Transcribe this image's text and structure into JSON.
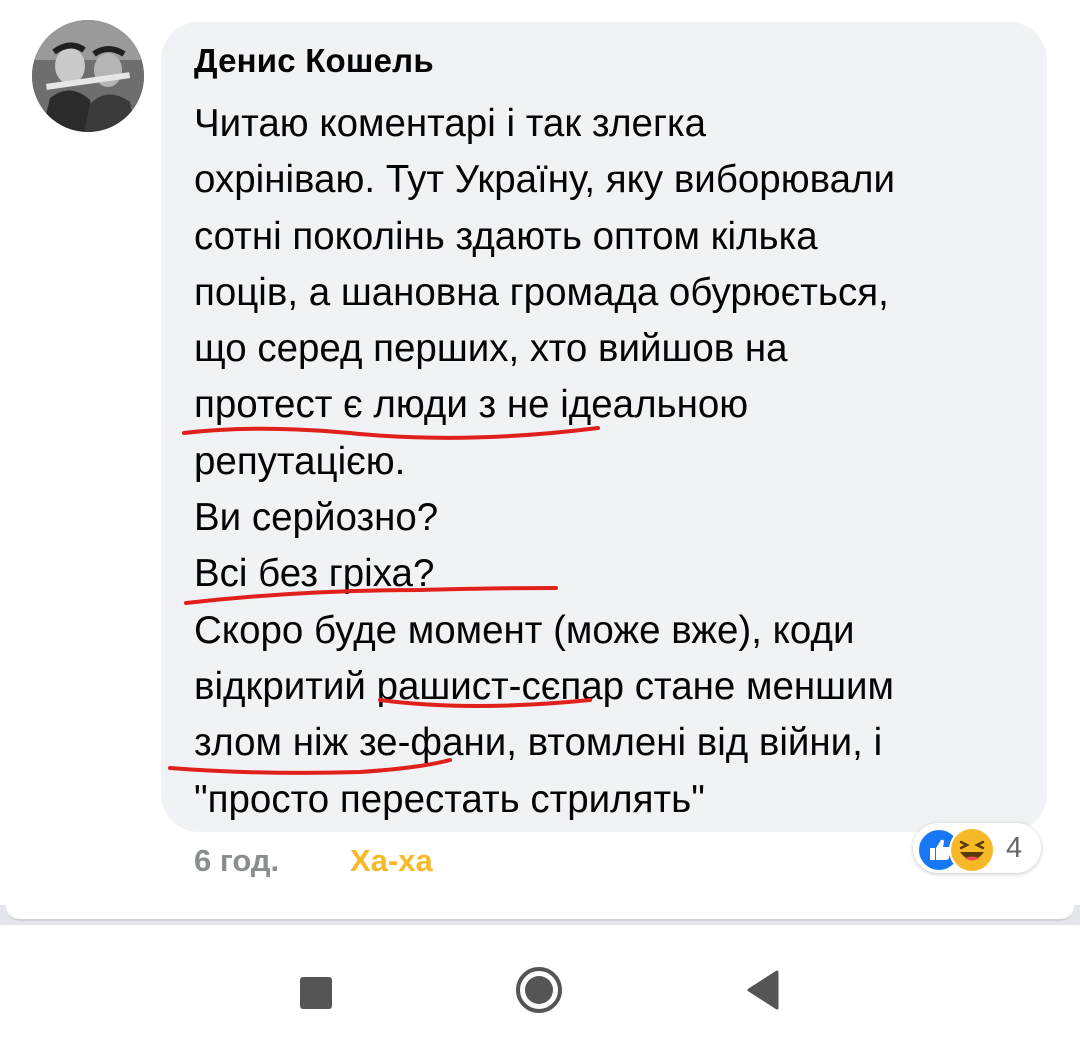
{
  "comment": {
    "author": "Денис Кошель",
    "lines": [
      "Читаю коментарі і так злегка",
      "охрініваю. Тут Україну, яку виборювали",
      "сотні поколінь здають оптом кілька",
      "поців, а шановна громада обурюється,",
      "що серед перших, хто вийшов на",
      "протест є люди з не ідеальною",
      "репутацією.",
      "Ви серйозно?",
      "Всі без гріха?",
      "Скоро буде момент (може вже), коди",
      "відкритий рашист-сєпар стане меншим",
      "злом ніж зе-фани, втомлені від війни, і",
      "\"просто перестать стрилять\""
    ],
    "time": "6 год.",
    "reaction_label": "Ха-ха",
    "reaction_count": "4",
    "reaction_icons": [
      "like-icon",
      "haha-icon"
    ],
    "underline_color": "#e0201b"
  },
  "colors": {
    "bubble": "#f0f2f5",
    "time": "#8a8d91",
    "reaction_label": "#f7b928",
    "like": "#1877f2",
    "haha": "#f7b928"
  },
  "navbar": {
    "buttons": [
      "recent-apps",
      "home",
      "back"
    ]
  }
}
